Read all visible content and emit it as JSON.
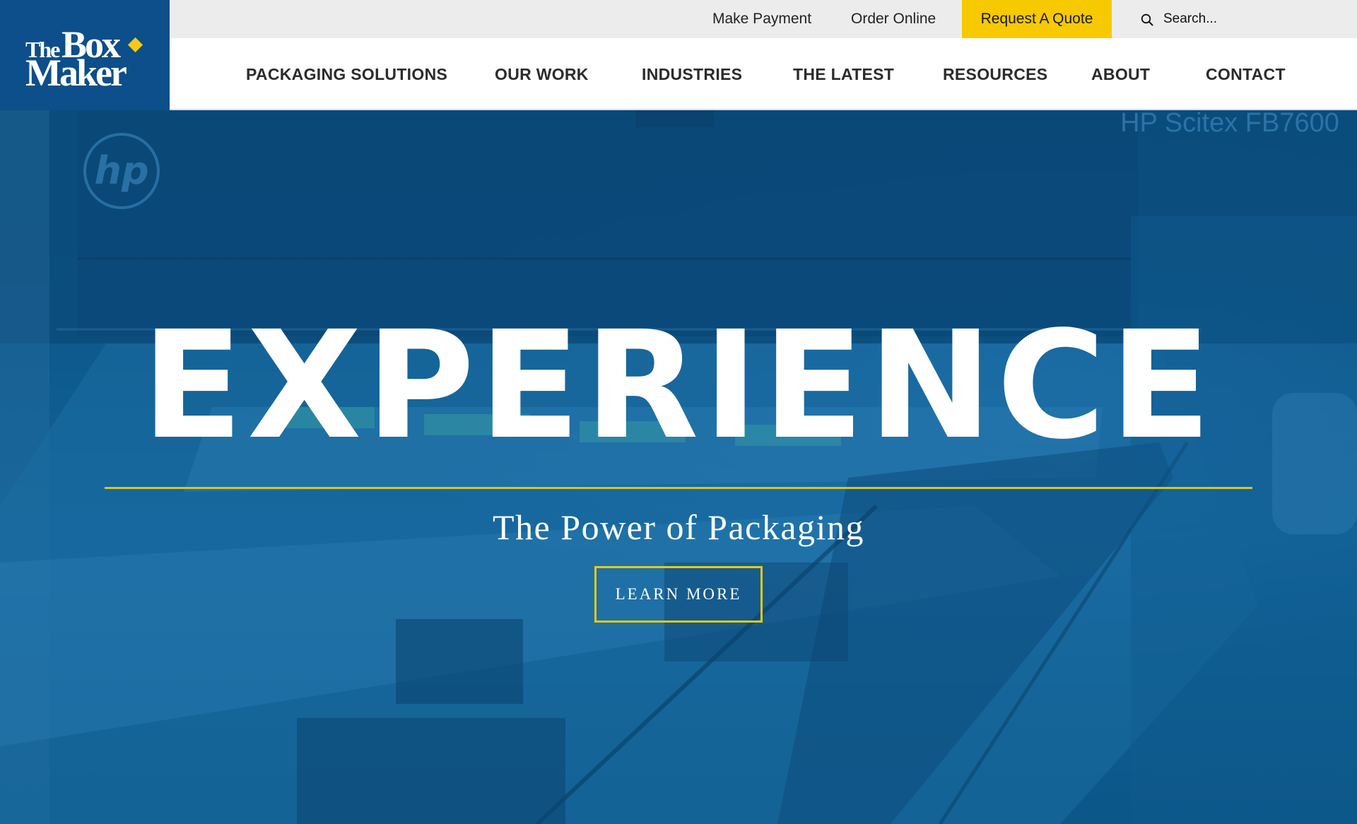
{
  "brand": {
    "logo_text_the": "The",
    "logo_text_box": "Box",
    "logo_text_maker": "Maker",
    "accent_color": "#f7c900",
    "brand_blue": "#0c4f8a"
  },
  "utility_nav": {
    "make_payment": "Make Payment",
    "order_online": "Order Online",
    "request_quote": "Request A Quote",
    "search_placeholder": "Search..."
  },
  "main_nav": {
    "items": [
      {
        "label": "PACKAGING SOLUTIONS"
      },
      {
        "label": "OUR WORK"
      },
      {
        "label": "INDUSTRIES"
      },
      {
        "label": "THE LATEST"
      },
      {
        "label": "RESOURCES"
      },
      {
        "label": "ABOUT"
      },
      {
        "label": "CONTACT"
      }
    ]
  },
  "hero": {
    "title": "EXPERIENCE",
    "subtitle": "The Power of Packaging",
    "button_label": "LEARN MORE",
    "machine_brand": "hp",
    "machine_model": "HP Scitex FB7600"
  }
}
